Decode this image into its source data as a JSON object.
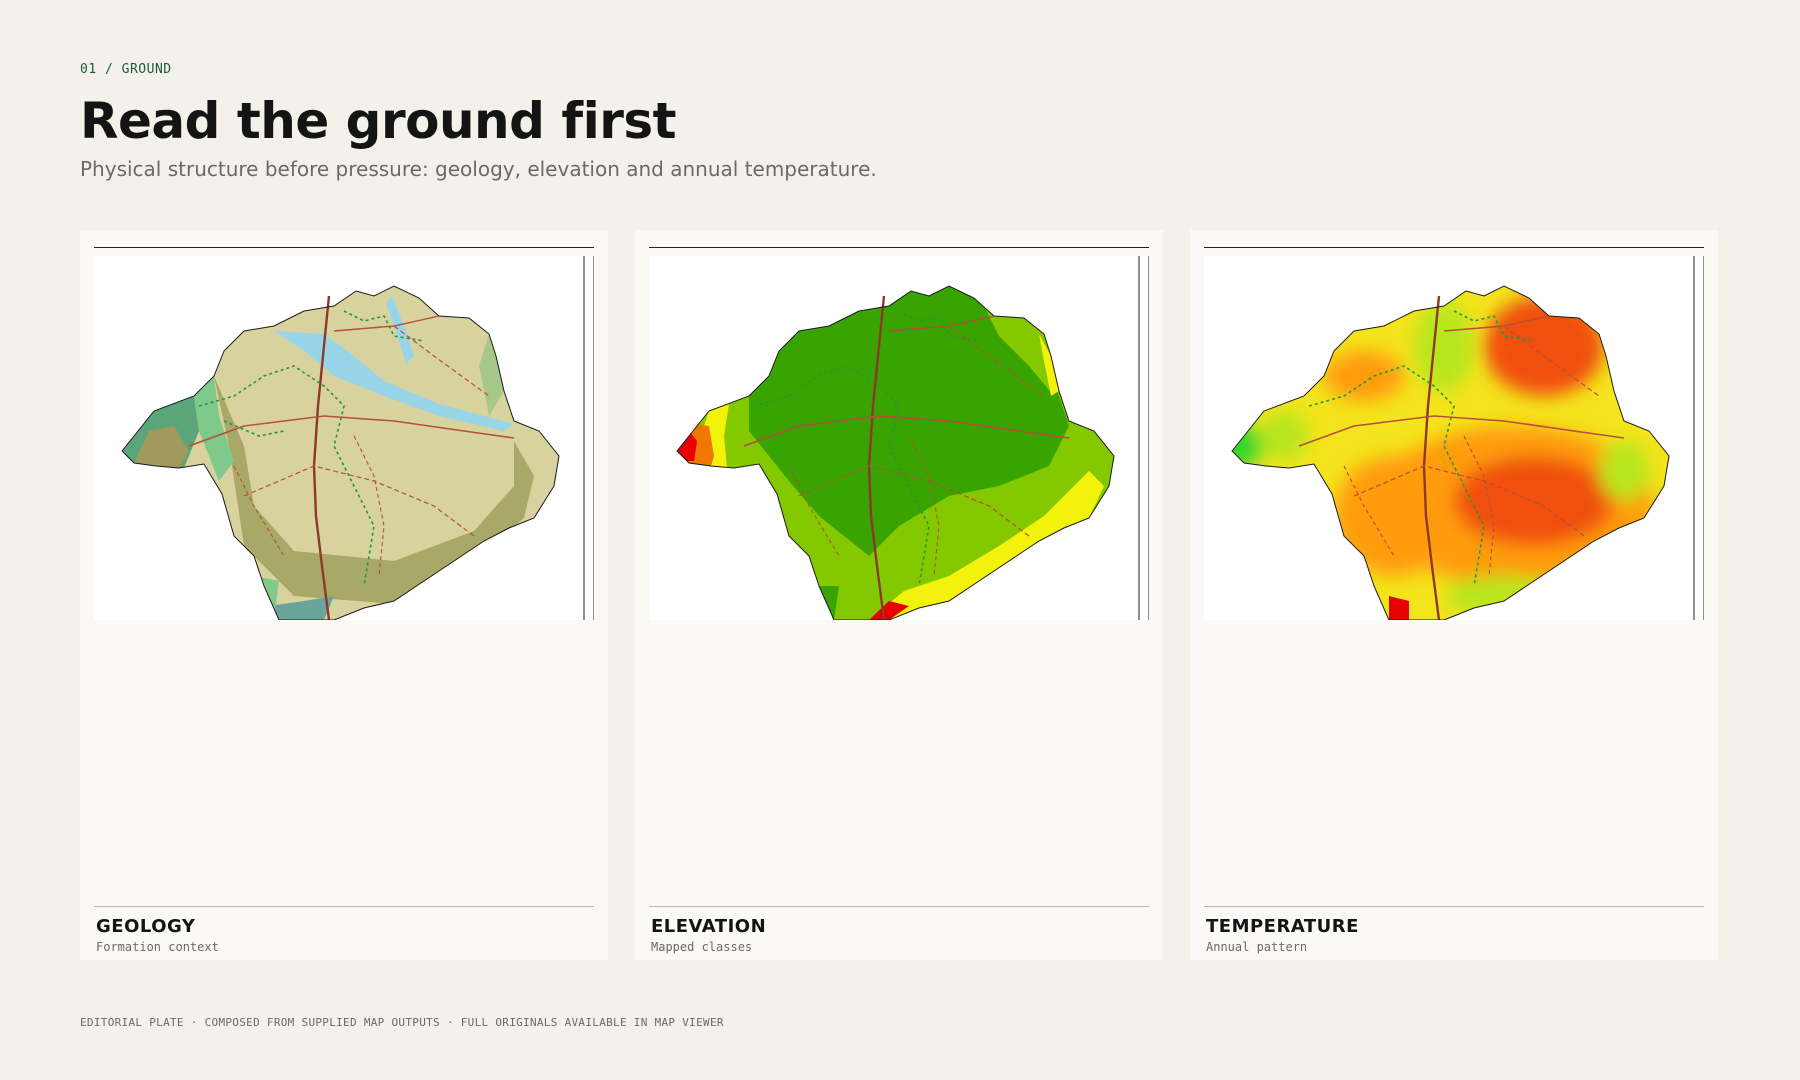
{
  "header": {
    "eyebrow": "01 / GROUND",
    "title": "Read the ground first",
    "subtitle": "Physical structure before pressure: geology, elevation and annual temperature."
  },
  "panels": [
    {
      "label": "GEOLOGY",
      "sublabel": "Formation context",
      "map_theme": "geology",
      "colors": [
        "#d8d29f",
        "#a8a867",
        "#99d5e8",
        "#7fc98a",
        "#5aa57a",
        "#a7c88a"
      ]
    },
    {
      "label": "ELEVATION",
      "sublabel": "Mapped classes",
      "map_theme": "elevation",
      "colors": [
        "#39a300",
        "#84c900",
        "#f2f20a",
        "#f07800",
        "#e80000"
      ]
    },
    {
      "label": "TEMPERATURE",
      "sublabel": "Annual pattern",
      "map_theme": "temperature",
      "colors": [
        "#f4e41c",
        "#ff9c0a",
        "#f0500a",
        "#b8e61a",
        "#2ed62a",
        "#e80000"
      ]
    }
  ],
  "map_symbols": {
    "road_color": "#8b3a2a",
    "road_minor_color": "#b5503a",
    "trail_color": "#1f9a3a",
    "border_color": "#1a1a1a"
  },
  "footer": {
    "note": "EDITORIAL PLATE · COMPOSED FROM SUPPLIED MAP OUTPUTS · FULL ORIGINALS AVAILABLE IN MAP VIEWER"
  }
}
